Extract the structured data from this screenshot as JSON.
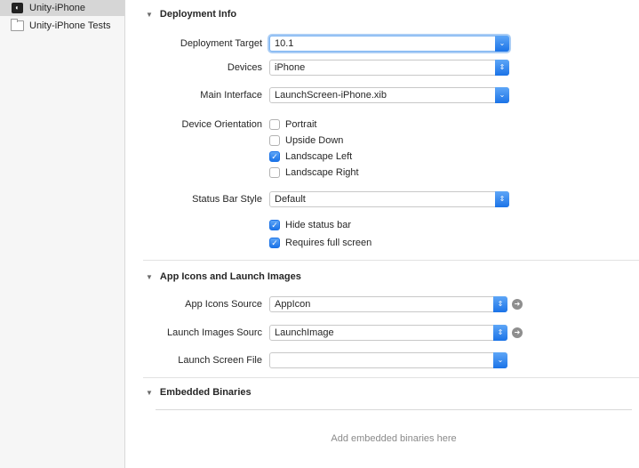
{
  "sidebar": {
    "targets": [
      {
        "label": "Unity-iPhone",
        "selected": true,
        "icon": "app-icon"
      },
      {
        "label": "Unity-iPhone Tests",
        "selected": false,
        "icon": "folder-icon"
      }
    ]
  },
  "deployment_info": {
    "title": "Deployment Info",
    "deployment_target": {
      "label": "Deployment Target",
      "value": "10.1"
    },
    "devices": {
      "label": "Devices",
      "value": "iPhone"
    },
    "main_interface": {
      "label": "Main Interface",
      "value": "LaunchScreen-iPhone.xib"
    },
    "device_orientation": {
      "label": "Device Orientation",
      "options": [
        {
          "label": "Portrait",
          "checked": false
        },
        {
          "label": "Upside Down",
          "checked": false
        },
        {
          "label": "Landscape Left",
          "checked": true
        },
        {
          "label": "Landscape Right",
          "checked": false
        }
      ]
    },
    "status_bar_style": {
      "label": "Status Bar Style",
      "value": "Default"
    },
    "hide_status_bar": {
      "label": "Hide status bar",
      "checked": true
    },
    "requires_full_screen": {
      "label": "Requires full screen",
      "checked": true
    }
  },
  "app_icons": {
    "title": "App Icons and Launch Images",
    "app_icons_source": {
      "label": "App Icons Source",
      "value": "AppIcon"
    },
    "launch_images_source": {
      "label": "Launch Images Sourc",
      "value": "LaunchImage"
    },
    "launch_screen_file": {
      "label": "Launch Screen File",
      "value": ""
    }
  },
  "embedded_binaries": {
    "title": "Embedded Binaries",
    "placeholder": "Add embedded binaries here"
  },
  "colors": {
    "accent": "#1b73e7",
    "sidebar_bg": "#f6f6f6",
    "selected_bg": "#d6d6d6"
  }
}
